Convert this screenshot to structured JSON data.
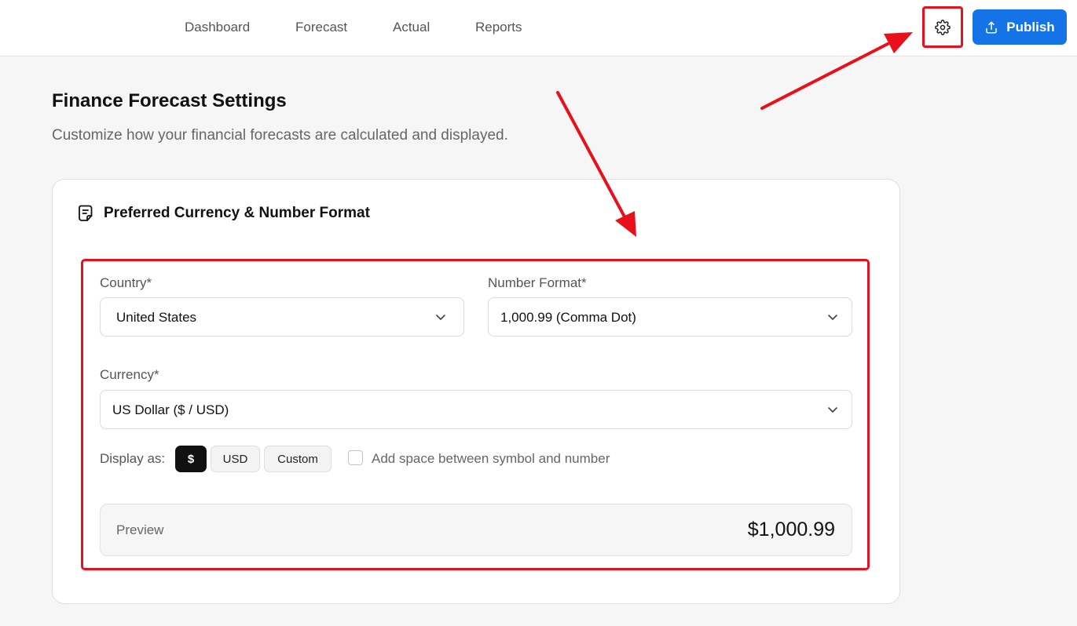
{
  "nav": {
    "items": [
      {
        "label": "Dashboard"
      },
      {
        "label": "Forecast"
      },
      {
        "label": "Actual"
      },
      {
        "label": "Reports"
      }
    ],
    "publish_label": "Publish"
  },
  "page": {
    "title": "Finance Forecast Settings",
    "subtitle": "Customize how your financial forecasts are calculated and displayed."
  },
  "card": {
    "title": "Preferred Currency & Number Format",
    "country": {
      "label": "Country*",
      "value": "United States"
    },
    "number_format": {
      "label": "Number Format*",
      "value": "1,000.99 (Comma Dot)"
    },
    "currency": {
      "label": "Currency*",
      "value": "US Dollar ($ / USD)"
    },
    "display_as": {
      "label": "Display as:",
      "options": [
        "$",
        "USD",
        "Custom"
      ],
      "selected": "$"
    },
    "space_checkbox": {
      "label": "Add space between symbol and number",
      "checked": false
    },
    "preview": {
      "label": "Preview",
      "value": "$1,000.99"
    }
  },
  "colors": {
    "accent": "#1473e6",
    "annotation": "#e8101a",
    "active_pill": "#111111"
  },
  "icons": [
    "gear-icon",
    "upload-icon",
    "document-icon",
    "chevron-down-icon"
  ]
}
